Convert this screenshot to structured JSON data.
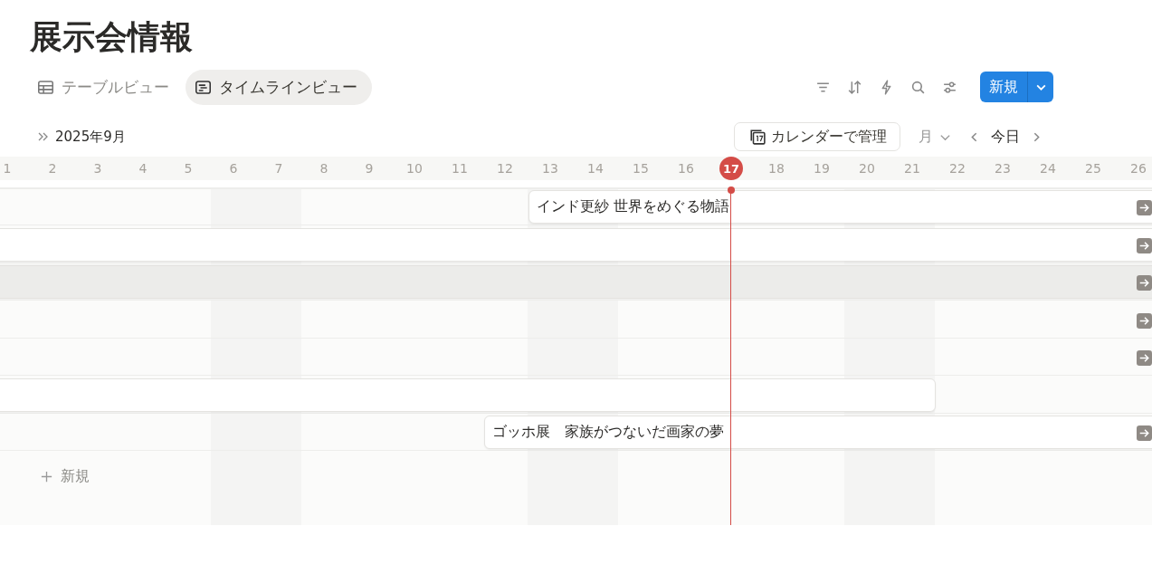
{
  "page": {
    "title": "展示会情報"
  },
  "views": [
    {
      "label": "テーブルビュー",
      "kind": "table",
      "selected": false
    },
    {
      "label": "タイムラインビュー",
      "kind": "timeline",
      "selected": true
    }
  ],
  "toolbar": {
    "new_button": "新規"
  },
  "timeline": {
    "month": "2025年9月",
    "calendar_button": "カレンダーで管理",
    "scale": "月",
    "today_button": "今日",
    "days": [
      {
        "label": "1",
        "weekend": false,
        "today": false
      },
      {
        "label": "2",
        "weekend": false,
        "today": false
      },
      {
        "label": "3",
        "weekend": false,
        "today": false
      },
      {
        "label": "4",
        "weekend": false,
        "today": false
      },
      {
        "label": "5",
        "weekend": false,
        "today": false
      },
      {
        "label": "6",
        "weekend": true,
        "today": false
      },
      {
        "label": "7",
        "weekend": true,
        "today": false
      },
      {
        "label": "8",
        "weekend": false,
        "today": false
      },
      {
        "label": "9",
        "weekend": false,
        "today": false
      },
      {
        "label": "10",
        "weekend": false,
        "today": false
      },
      {
        "label": "11",
        "weekend": false,
        "today": false
      },
      {
        "label": "12",
        "weekend": false,
        "today": false
      },
      {
        "label": "13",
        "weekend": true,
        "today": false
      },
      {
        "label": "14",
        "weekend": true,
        "today": false
      },
      {
        "label": "15",
        "weekend": false,
        "today": false
      },
      {
        "label": "16",
        "weekend": false,
        "today": false
      },
      {
        "label": "17",
        "weekend": false,
        "today": true
      },
      {
        "label": "18",
        "weekend": false,
        "today": false
      },
      {
        "label": "19",
        "weekend": false,
        "today": false
      },
      {
        "label": "20",
        "weekend": true,
        "today": false
      },
      {
        "label": "21",
        "weekend": true,
        "today": false
      },
      {
        "label": "22",
        "weekend": false,
        "today": false
      },
      {
        "label": "23",
        "weekend": false,
        "today": false
      },
      {
        "label": "24",
        "weekend": false,
        "today": false
      },
      {
        "label": "25",
        "weekend": false,
        "today": false
      },
      {
        "label": "26",
        "weekend": false,
        "today": false
      }
    ],
    "rows": [
      {
        "kind": "bar",
        "title": "インド更紗 世界をめぐる物語",
        "hovered": false,
        "continues": true
      },
      {
        "kind": "bar",
        "hovered": false,
        "continues": true
      },
      {
        "kind": "bar",
        "hovered": true,
        "continues": true
      },
      {
        "kind": "offscreen",
        "hovered": false,
        "continues": true
      },
      {
        "kind": "offscreen",
        "hovered": false,
        "continues": true
      },
      {
        "kind": "bar",
        "hovered": false,
        "continues": false
      },
      {
        "kind": "bar",
        "title": "ゴッホ展　家族がつないだ画家の夢",
        "hovered": false,
        "continues": true
      }
    ],
    "new_row": "新規"
  }
}
